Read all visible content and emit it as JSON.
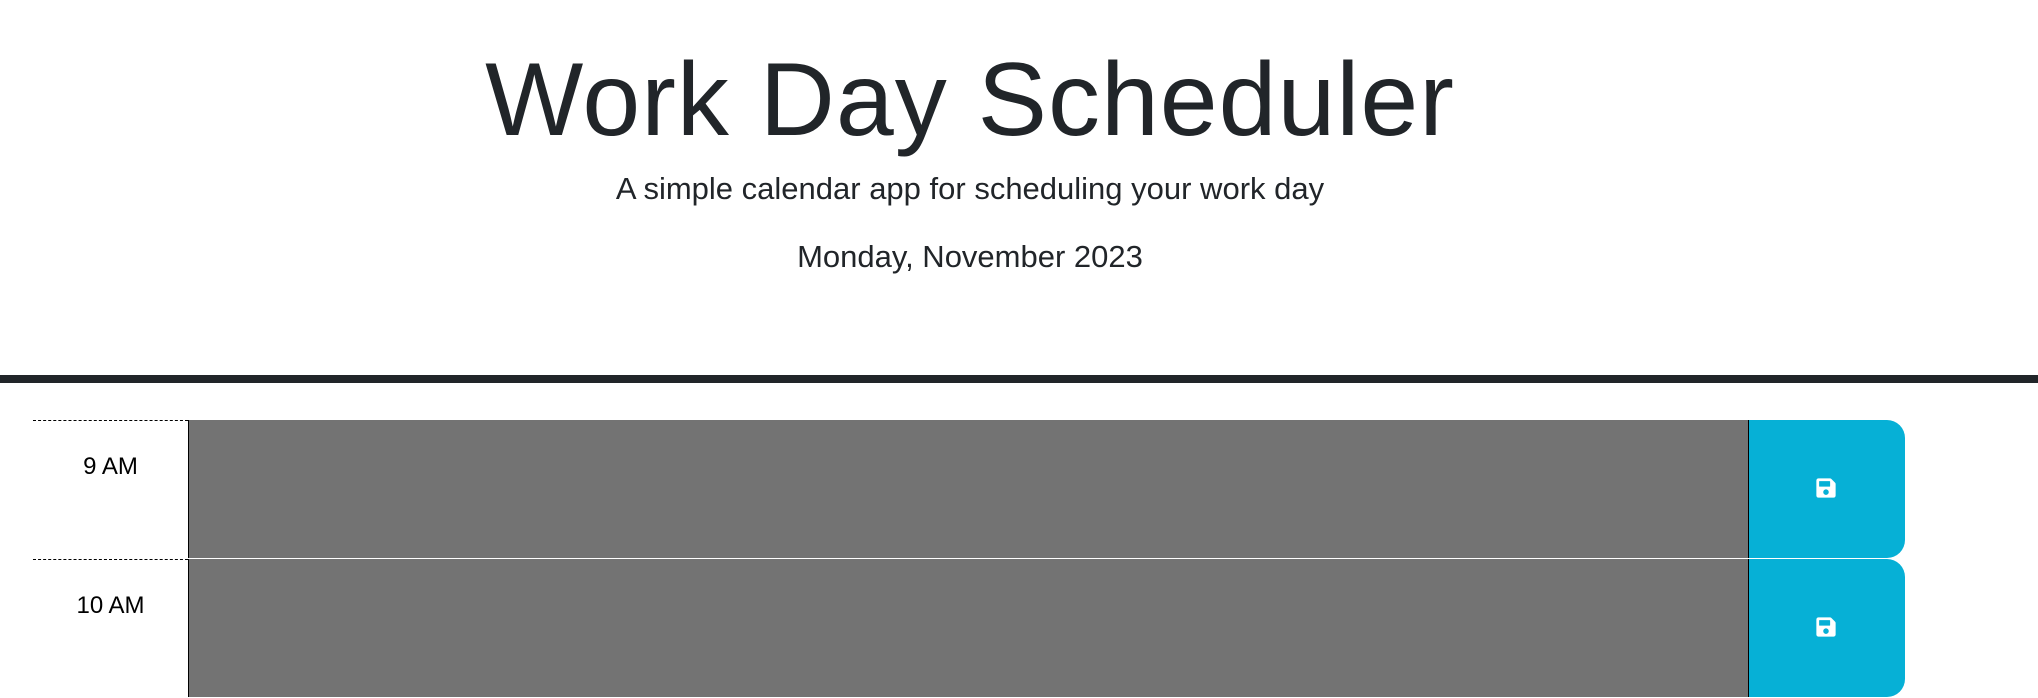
{
  "header": {
    "title": "Work Day Scheduler",
    "subtitle": "A simple calendar app for scheduling your work day",
    "current_day": "Monday, November 2023"
  },
  "rows": [
    {
      "hour": "9 AM",
      "text": "",
      "save_icon": "save-icon"
    },
    {
      "hour": "10 AM",
      "text": "",
      "save_icon": "save-icon"
    }
  ],
  "colors": {
    "past": "#737373",
    "save_button": "#06b0d6",
    "header_border": "#212529"
  }
}
